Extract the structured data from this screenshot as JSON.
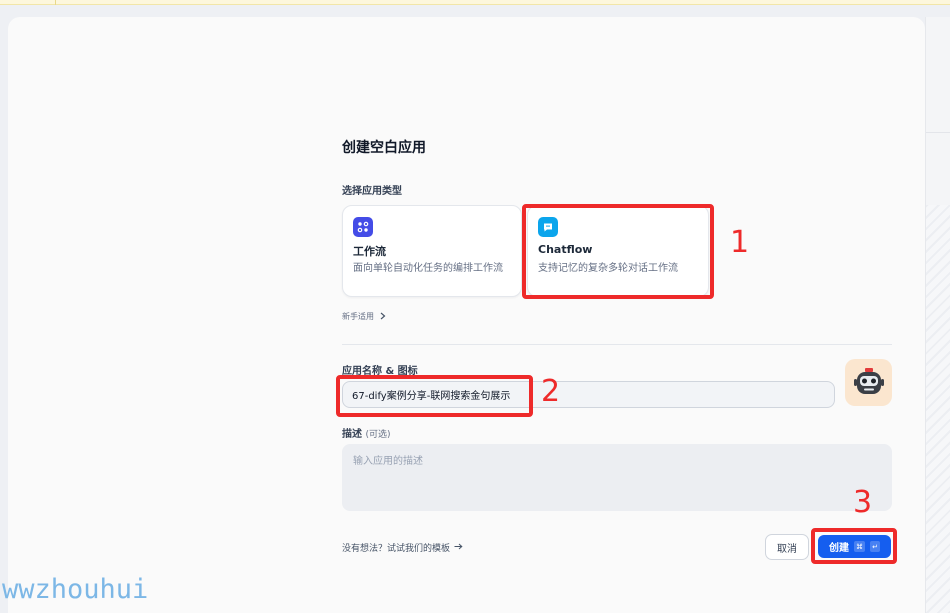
{
  "dialog": {
    "title": "创建空白应用",
    "type_section_label": "选择应用类型",
    "app_types": [
      {
        "name": "工作流",
        "description": "面向单轮自动化任务的编排工作流",
        "icon": "workflow-icon"
      },
      {
        "name": "Chatflow",
        "description": "支持记忆的复杂多轮对话工作流",
        "icon": "chat-bubble-icon"
      }
    ],
    "beginner_label": "新手适用",
    "name_icon_label": "应用名称 & 图标",
    "app_name_value": "67-dify案例分享-联网搜索金句展示",
    "description_label": "描述",
    "description_optional": "(可选)",
    "description_placeholder": "输入应用的描述",
    "template_link": "没有想法？试试我们的模板",
    "cancel_label": "取消",
    "create_label": "创建",
    "create_shortcut_keys": [
      "⌘",
      "↵"
    ]
  },
  "annotations": [
    "1",
    "2",
    "3"
  ],
  "watermark": "wwzhouhui",
  "colors": {
    "primary": "#155eef",
    "workflow_icon_bg": "#444ce7",
    "chatflow_icon_bg": "#0ba5ec",
    "annotation_red": "#ee2a2a",
    "avatar_bg": "#fbe6cf"
  }
}
